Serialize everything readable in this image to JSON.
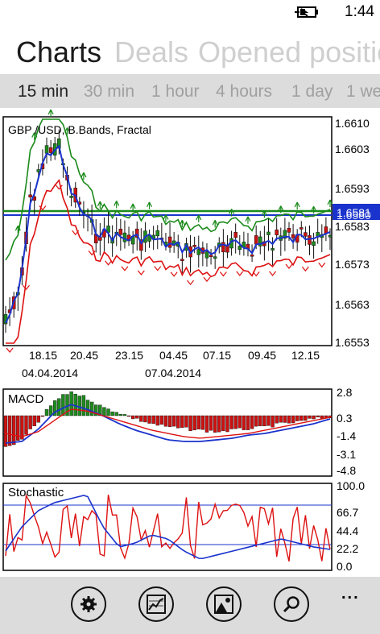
{
  "status": {
    "time": "1:44",
    "battery_icon": "battery-charging-icon"
  },
  "pivot": {
    "items": [
      "Charts",
      "Deals",
      "Opened positio"
    ],
    "active": 0
  },
  "timeframes": {
    "items": [
      "15 min",
      "30 min",
      "1 hour",
      "4 hours",
      "1 day",
      "1 we"
    ],
    "active": 0
  },
  "main_chart": {
    "title": "GBP /USD, B.Bands, Fractal",
    "y_ticks": [
      "1.6610",
      "1.6603",
      "1.6593",
      "1.6583",
      "1.6573",
      "1.6563",
      "1.6553"
    ],
    "price_tag_upper": "1.6581",
    "price_tag_lower": "1.6580",
    "x_ticks": [
      "18.15",
      "20.45",
      "23.15",
      "04.45",
      "07.15",
      "09.45",
      "12.15"
    ],
    "dates": [
      "04.04.2014",
      "07.04.2014"
    ],
    "colors": {
      "bull": "#1e8a1e",
      "bear": "#cc1111",
      "band_upper": "#1a8a1a",
      "band_mid": "#1a33cc",
      "band_lower": "#dd1111"
    }
  },
  "macd": {
    "title": "MACD",
    "y_ticks": [
      "2.8",
      "0.3",
      "-1.4",
      "-3.1",
      "-4.8"
    ]
  },
  "stochastic": {
    "title": "Stochastic",
    "y_ticks": [
      "100.0",
      "66.7",
      "44.4",
      "22.2",
      "0.0"
    ]
  },
  "appbar": {
    "buttons": [
      {
        "name": "settings",
        "icon": "gear-icon"
      },
      {
        "name": "chart-type",
        "icon": "line-chart-icon"
      },
      {
        "name": "indicators",
        "icon": "picture-icon"
      },
      {
        "name": "zoom",
        "icon": "magnifier-icon"
      }
    ],
    "more": "..."
  }
}
